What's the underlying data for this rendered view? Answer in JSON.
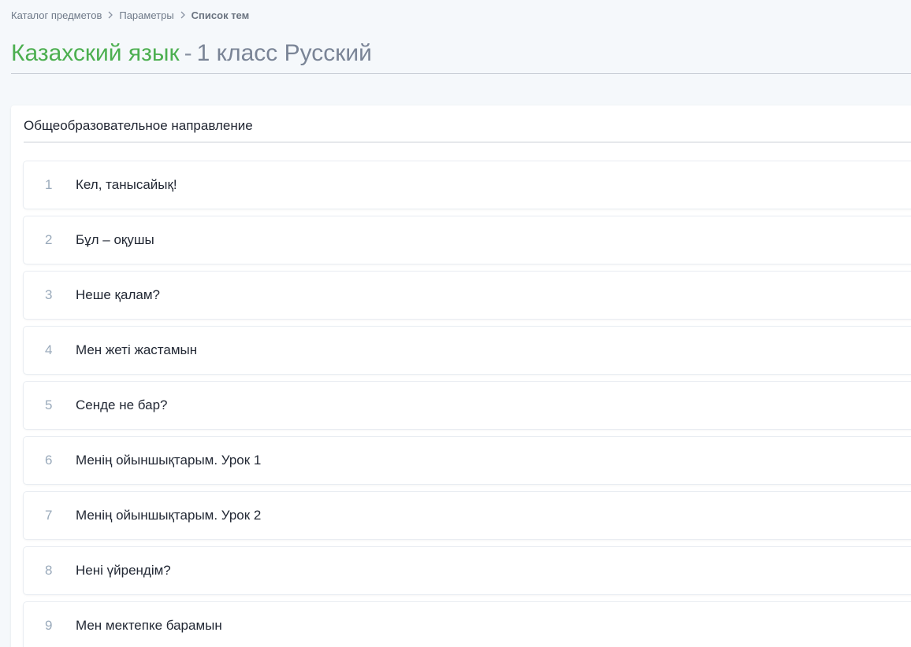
{
  "breadcrumb": {
    "items": [
      "Каталог предметов",
      "Параметры"
    ],
    "current": "Список тем"
  },
  "title": {
    "subject": "Казахский язык",
    "separator": "-",
    "grade": "1 класс Русский"
  },
  "colors": {
    "subject": "#4caf50",
    "grade": "#7a8496",
    "number": "#9aaabb",
    "background": "#f5f8fb"
  },
  "section": {
    "heading": "Общеобразовательное направление",
    "topics": [
      {
        "number": "1",
        "title": "Кел, танысайық!"
      },
      {
        "number": "2",
        "title": "Бұл – оқушы"
      },
      {
        "number": "3",
        "title": "Неше қалам?"
      },
      {
        "number": "4",
        "title": "Мен жеті жастамын"
      },
      {
        "number": "5",
        "title": "Сенде не бар?"
      },
      {
        "number": "6",
        "title": "Менің ойыншықтарым. Урок 1"
      },
      {
        "number": "7",
        "title": "Менің ойыншықтарым. Урок 2"
      },
      {
        "number": "8",
        "title": "Нені үйрендім?"
      },
      {
        "number": "9",
        "title": "Мен мектепке барамын"
      }
    ]
  }
}
